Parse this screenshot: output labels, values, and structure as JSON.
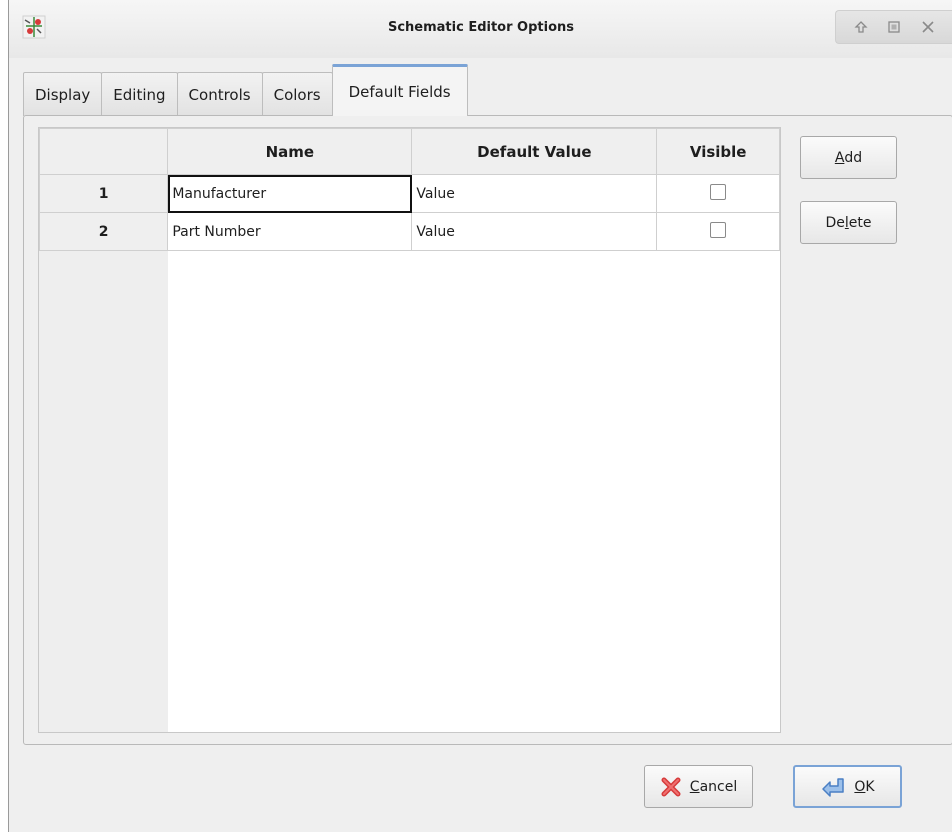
{
  "window": {
    "title": "Schematic Editor Options",
    "icon": "kicad-eeschema-icon"
  },
  "tabs": [
    {
      "label": "Display",
      "active": false
    },
    {
      "label": "Editing",
      "active": false
    },
    {
      "label": "Controls",
      "active": false
    },
    {
      "label": "Colors",
      "active": false
    },
    {
      "label": "Default Fields",
      "active": true
    }
  ],
  "grid": {
    "columns": [
      "Name",
      "Default Value",
      "Visible"
    ],
    "rows": [
      {
        "label": "1",
        "name": "Manufacturer",
        "default_value": "Value",
        "visible": false
      },
      {
        "label": "2",
        "name": "Part Number",
        "default_value": "Value",
        "visible": false
      }
    ]
  },
  "buttons": {
    "add": {
      "label": "Add",
      "mnemonic": "A",
      "rest": "dd"
    },
    "delete": {
      "label": "Delete",
      "pre": "De",
      "mnemonic": "l",
      "rest": "ete"
    },
    "cancel": {
      "label": "Cancel",
      "mnemonic": "C",
      "rest": "ancel"
    },
    "ok": {
      "label": "OK",
      "mnemonic": "O",
      "rest": "K"
    }
  },
  "colors": {
    "accent": "#7aa3d6",
    "cancel_icon": "#d63a3a",
    "ok_icon": "#4a7fc4"
  }
}
